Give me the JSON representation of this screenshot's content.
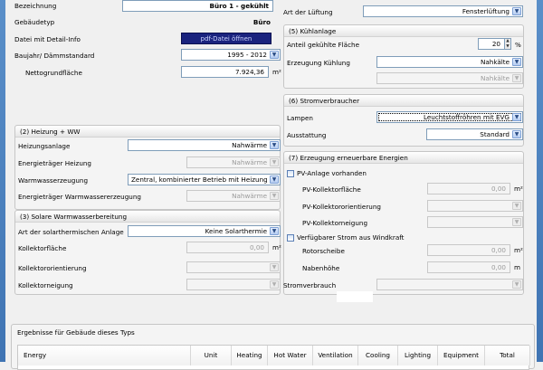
{
  "general": {
    "bezeichnung_label": "Bezeichnung",
    "bezeichnung_value": "Büro 1 - gekühlt",
    "gebaeudetyp_label": "Gebäudetyp",
    "gebaeudetyp_value": "Büro",
    "detail_label": "Datei mit Detail-Info",
    "detail_button": "pdf-Datei öffnen",
    "baujahr_label": "Baujahr/ Dämmstandard",
    "baujahr_value": "1995 - 2012",
    "nettogrund_label": "Nettogrundfläche",
    "nettogrund_value": "7.924,36",
    "nettogrund_unit": "m²"
  },
  "lueftung": {
    "art_label": "Art der Lüftung",
    "art_value": "Fensterlüftung"
  },
  "heizung": {
    "title": "(2) Heizung + WW",
    "anlage_label": "Heizungsanlage",
    "anlage_value": "Nahwärme",
    "traeger_label": "Energieträger Heizung",
    "traeger_value": "Nahwärme",
    "ww_label": "Warmwasserzeugung",
    "ww_value": "Zentral, kombinierter Betrieb mit Heizung",
    "ww_traeger_label": "Energieträger Warmwassererzeugung",
    "ww_traeger_value": "Nahwärme"
  },
  "solar": {
    "title": "(3) Solare Warmwasserbereitung",
    "art_label": "Art der solarthermischen Anlage",
    "art_value": "Keine Solarthermie",
    "flaeche_label": "Kollektorfläche",
    "flaeche_value": "0,00",
    "flaeche_unit": "m²",
    "orient_label": "Kollektororientierung",
    "neigung_label": "Kollektorneigung"
  },
  "kuehl": {
    "title": "(5) Kühlanlage",
    "anteil_label": "Anteil gekühlte Fläche",
    "anteil_value": "20",
    "anteil_unit": "%",
    "erzeugung_label": "Erzeugung Kühlung",
    "erzeugung_value": "Nahkälte",
    "erzeugung2_value": "Nahkälte"
  },
  "strom": {
    "title": "(6) Stromverbraucher",
    "lampen_label": "Lampen",
    "lampen_value": "Leuchtstoffröhren mit EVG",
    "ausstattung_label": "Ausstattung",
    "ausstattung_value": "Standard"
  },
  "erneuerbar": {
    "title": "(7) Erzeugung erneuerbare Energien",
    "pv_check": "PV-Anlage vorhanden",
    "pv_flaeche_label": "PV-Kollektorfläche",
    "pv_flaeche_value": "0,00",
    "pv_flaeche_unit": "m²",
    "pv_orient_label": "PV-Kollektororientierung",
    "pv_neigung_label": "PV-Kollektorneigung",
    "wind_check": "Verfügbarer Strom aus Windkraft",
    "rotor_label": "Rotorscheibe",
    "rotor_value": "0,00",
    "rotor_unit": "m²",
    "naben_label": "Nabenhöhe",
    "naben_value": "0,00",
    "naben_unit": "m",
    "verbrauch_label": "Stromverbrauch"
  },
  "results": {
    "title": "Ergebnisse für Gebäude dieses Typs",
    "columns": [
      "Energy",
      "Unit",
      "Heating",
      "Hot Water",
      "Ventilation",
      "Cooling",
      "Lighting",
      "Equipment",
      "Total"
    ]
  },
  "icons": {
    "dropdown": "chevron-down-icon",
    "spin": "spin-arrows-icon"
  }
}
